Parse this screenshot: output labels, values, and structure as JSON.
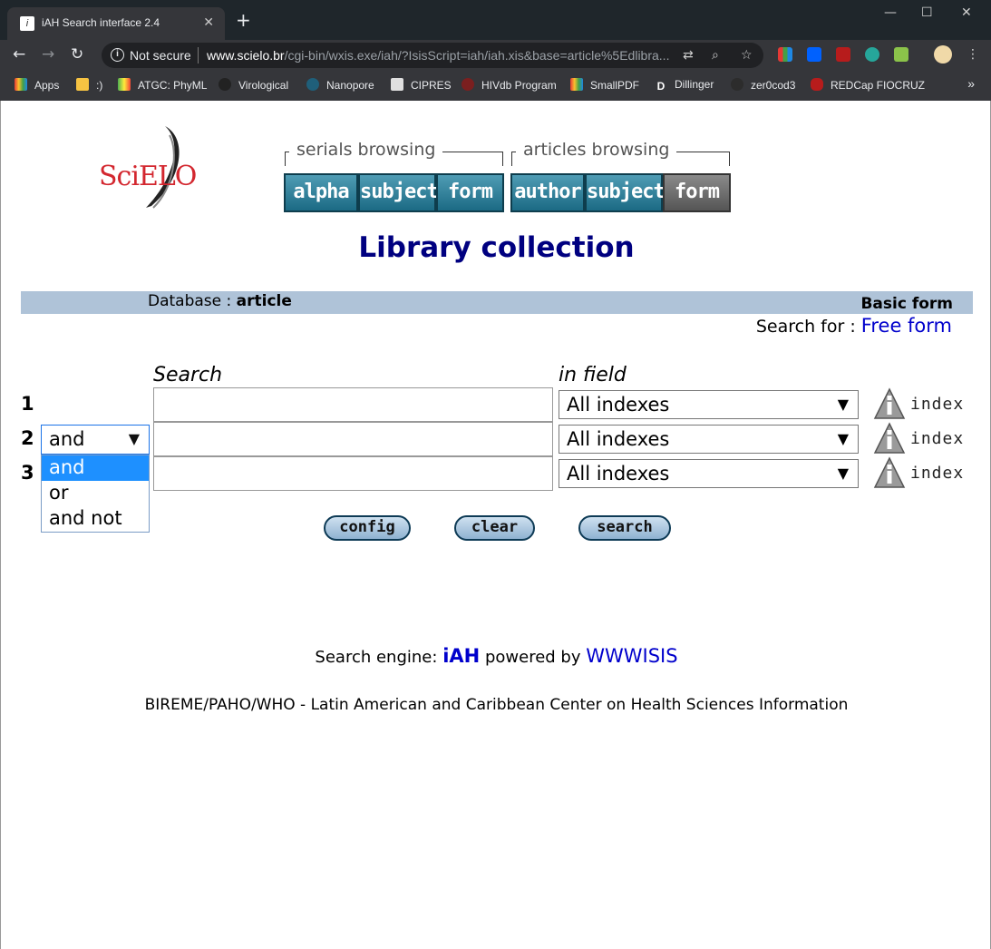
{
  "browser": {
    "tab_title": "iAH Search interface 2.4",
    "new_tab": "+",
    "not_secure": "Not secure",
    "url_host": "www.scielo.br",
    "url_path": "/cgi-bin/wxis.exe/iah/?IsisScript=iah/iah.xis&base=article%5Edlibra...",
    "bookmarks": [
      "Apps",
      ":)",
      "ATGC: PhyML",
      "Virological",
      "Nanopore",
      "CIPRES",
      "HIVdb Program",
      "SmallPDF",
      "Dillinger",
      "zer0cod3",
      "REDCap FIOCRUZ"
    ],
    "bookmarks_more": "»"
  },
  "logo": {
    "text": "SciELO"
  },
  "serials": {
    "label": "serials browsing",
    "buttons": [
      "alpha",
      "subject",
      "form"
    ]
  },
  "articles": {
    "label": "articles browsing",
    "buttons": [
      "author",
      "subject",
      "form"
    ]
  },
  "title": "Library collection",
  "database": {
    "label": "Database :",
    "value": "article",
    "form_mode": "Basic form"
  },
  "search_for": {
    "label": "Search for :",
    "link": "Free form"
  },
  "columns": {
    "search": "Search",
    "field": "in field"
  },
  "rows": [
    {
      "num": "1",
      "field": "All indexes",
      "index": "index"
    },
    {
      "num": "2",
      "field": "All indexes",
      "index": "index",
      "bool": "and"
    },
    {
      "num": "3",
      "field": "All indexes",
      "index": "index"
    }
  ],
  "bool_options": [
    "and",
    "or",
    "and not"
  ],
  "actions": {
    "config": "config",
    "clear": "clear",
    "search": "search"
  },
  "footer": {
    "engine_prefix": "Search engine:",
    "engine": "iAH",
    "powered": "powered by",
    "powered_link": "WWWISIS",
    "org": "BIREME/PAHO/WHO - Latin American and Caribbean Center on Health Sciences Information"
  }
}
